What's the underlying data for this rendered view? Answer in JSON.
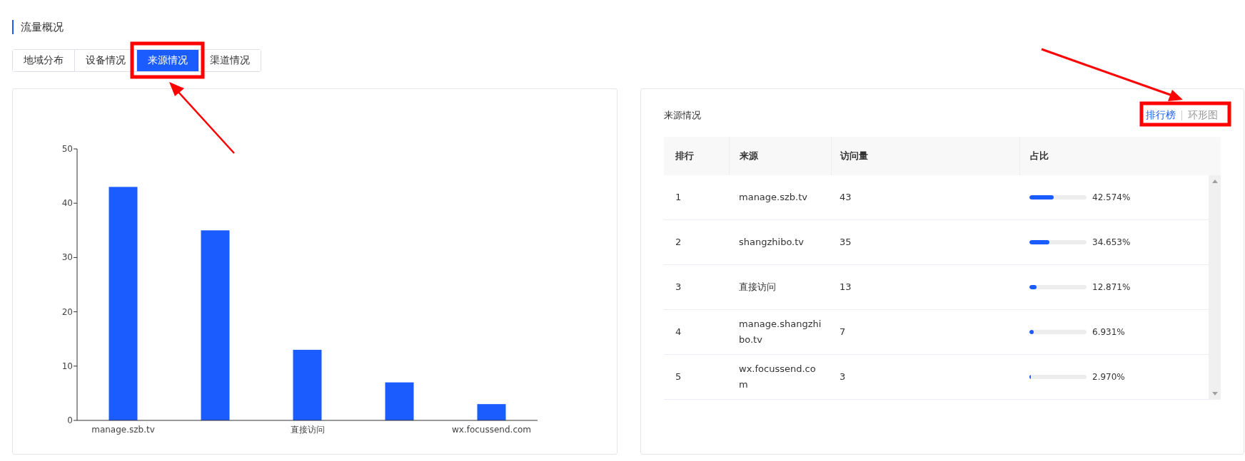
{
  "section_title": "流量概况",
  "tabs": [
    {
      "label": "地域分布",
      "selected": false
    },
    {
      "label": "设备情况",
      "selected": false
    },
    {
      "label": "来源情况",
      "selected": true
    },
    {
      "label": "渠道情况",
      "selected": false
    }
  ],
  "chart": {
    "chart_data": {
      "type": "bar",
      "categories": [
        "manage.szb.tv",
        null,
        "直接访问",
        null,
        "wx.focussend.com"
      ],
      "series": [
        {
          "color": "#1a5cff",
          "values": [
            43,
            35,
            13,
            7,
            3
          ]
        }
      ],
      "ylim": [
        0,
        50
      ],
      "yticks": [
        0,
        10,
        20,
        30,
        40,
        50
      ]
    }
  },
  "panel": {
    "title": "来源情况",
    "view_toggle": [
      {
        "label": "排行榜",
        "selected": true
      },
      {
        "label": "环形图",
        "selected": false
      }
    ],
    "table": {
      "columns": [
        "排行",
        "来源",
        "访问量",
        "占比"
      ],
      "rows": [
        {
          "rank": "1",
          "source": "manage.szb.tv",
          "visits": "43",
          "level": 0.42574,
          "share": "42.574%"
        },
        {
          "rank": "2",
          "source": "shangzhibo.tv",
          "visits": "35",
          "level": 0.34653,
          "share": "34.653%"
        },
        {
          "rank": "3",
          "source": "直接访问",
          "visits": "13",
          "level": 0.12871,
          "share": "12.871%"
        },
        {
          "rank": "4",
          "source": "manage.shangzhibo.tv",
          "visits": "7",
          "level": 0.06931,
          "share": "6.931%"
        },
        {
          "rank": "5",
          "source": "wx.focussend.com",
          "visits": "3",
          "level": 0.0297,
          "share": "2.970%"
        }
      ]
    }
  }
}
